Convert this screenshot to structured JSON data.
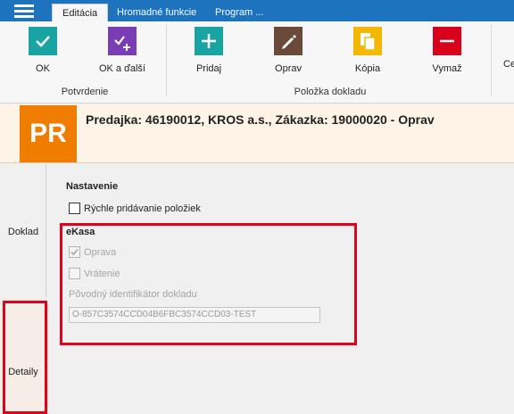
{
  "tabs": [
    {
      "label": "Editácia",
      "active": true
    },
    {
      "label": "Hromadné funkcie",
      "active": false
    },
    {
      "label": "Program ...",
      "active": false
    }
  ],
  "ribbon": {
    "buttons": [
      {
        "id": "ok",
        "label": "OK",
        "icon": "check-icon",
        "color": "#1aa3a3"
      },
      {
        "id": "ok-next",
        "label": "OK a ďalší",
        "icon": "check-plus-icon",
        "color": "#7b3db5"
      },
      {
        "id": "add",
        "label": "Pridaj",
        "icon": "plus-icon",
        "color": "#1aa3a3"
      },
      {
        "id": "edit",
        "label": "Oprav",
        "icon": "pencil-icon",
        "color": "#6b4a3a"
      },
      {
        "id": "copy",
        "label": "Kópia",
        "icon": "copy-icon",
        "color": "#f5b800"
      },
      {
        "id": "delete",
        "label": "Vymaž",
        "icon": "minus-icon",
        "color": "#d9001b"
      },
      {
        "id": "cut",
        "label": "Ce"
      }
    ],
    "groups": {
      "confirm": "Potvrdenie",
      "item": "Položka dokladu"
    }
  },
  "header": {
    "badge": "PR",
    "title": "Predajka: 46190012, KROS a.s., Zákazka: 19000020 - Oprav",
    "accent": "#ef7d00"
  },
  "side_tabs": [
    {
      "label": "Doklad",
      "selected": false
    },
    {
      "label": "Detaily",
      "selected": true
    }
  ],
  "settings": {
    "heading": "Nastavenie",
    "quick_add": {
      "label": "Rýchle pridávanie položiek",
      "checked": false
    }
  },
  "ekasa": {
    "heading": "eKasa",
    "oprava": {
      "label": "Oprava",
      "checked": true,
      "disabled": true
    },
    "vratenie": {
      "label": "Vrátenie",
      "checked": false,
      "disabled": true
    },
    "id_label": "Pôvodný identifikátor dokladu",
    "id_value": "O-857C3574CCD04B6FBC3574CCD03-TEST"
  },
  "highlight_color": "#e3001b"
}
